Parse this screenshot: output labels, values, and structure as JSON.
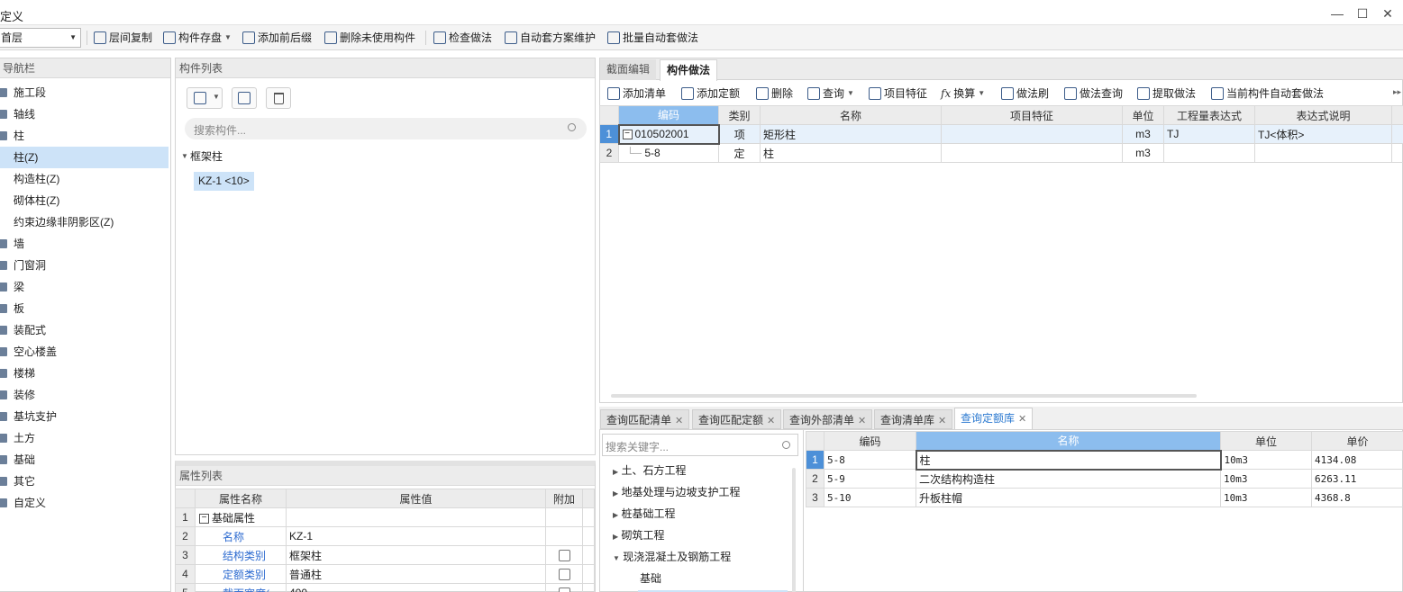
{
  "window": {
    "title": "定义",
    "minimize": "—",
    "maximize": "☐",
    "close": "✕"
  },
  "toolbar": {
    "floor_select": "首层",
    "items": [
      "层间复制",
      "构件存盘",
      "添加前后缀",
      "删除未使用构件",
      "检查做法",
      "自动套方案维护",
      "批量自动套做法"
    ]
  },
  "nav": {
    "title": "导航栏",
    "items": [
      "施工段",
      "轴线",
      "柱",
      "柱(Z)",
      "构造柱(Z)",
      "砌体柱(Z)",
      "约束边缘非阴影区(Z)",
      "墙",
      "门窗洞",
      "梁",
      "板",
      "装配式",
      "空心楼盖",
      "楼梯",
      "装修",
      "基坑支护",
      "土方",
      "基础",
      "其它",
      "自定义"
    ]
  },
  "component_list": {
    "title": "构件列表",
    "search_placeholder": "搜索构件...",
    "group": "框架柱",
    "item": "KZ-1 <10>"
  },
  "property_list": {
    "title": "属性列表",
    "headers": [
      "属性名称",
      "属性值",
      "附加"
    ],
    "rows": [
      {
        "n": "1",
        "name": "基础属性",
        "value": ""
      },
      {
        "n": "2",
        "name": "名称",
        "value": "KZ-1"
      },
      {
        "n": "3",
        "name": "结构类别",
        "value": "框架柱"
      },
      {
        "n": "4",
        "name": "定额类别",
        "value": "普通柱"
      },
      {
        "n": "5",
        "name": "截面宽度(",
        "value": "400"
      }
    ]
  },
  "right": {
    "tabs": [
      "截面编辑",
      "构件做法"
    ],
    "actions": [
      "添加清单",
      "添加定额",
      "删除",
      "查询",
      "项目特征",
      "换算",
      "做法刷",
      "做法查询",
      "提取做法",
      "当前构件自动套做法"
    ],
    "headers": [
      "编码",
      "类别",
      "名称",
      "项目特征",
      "单位",
      "工程量表达式",
      "表达式说明"
    ],
    "rows": [
      {
        "n": "1",
        "code": "010502001",
        "type": "项",
        "name": "矩形柱",
        "feature": "",
        "unit": "m3",
        "expr": "TJ",
        "desc": "TJ<体积>"
      },
      {
        "n": "2",
        "code": "5-8",
        "type": "定",
        "name": "柱",
        "feature": "",
        "unit": "m3",
        "expr": "",
        "desc": ""
      }
    ]
  },
  "bottom": {
    "tabs": [
      "查询匹配清单",
      "查询匹配定额",
      "查询外部清单",
      "查询清单库",
      "查询定额库"
    ],
    "search_placeholder": "搜索关键字...",
    "tree": [
      "土、石方工程",
      "地基处理与边坡支护工程",
      "桩基础工程",
      "砌筑工程",
      "现浇混凝土及钢筋工程",
      "基础"
    ],
    "headers": [
      "编码",
      "名称",
      "单位",
      "单价"
    ],
    "rows": [
      {
        "n": "1",
        "code": "5-8",
        "name": "柱",
        "unit": "10m3",
        "price": "4134.08"
      },
      {
        "n": "2",
        "code": "5-9",
        "name": "二次结构构造柱",
        "unit": "10m3",
        "price": "6263.11"
      },
      {
        "n": "3",
        "code": "5-10",
        "name": "升板柱帽",
        "unit": "10m3",
        "price": "4368.8"
      }
    ]
  },
  "colors": {
    "accent": "#2b79d0",
    "selection": "#cde3f8",
    "header_selected": "#8cbdee"
  }
}
